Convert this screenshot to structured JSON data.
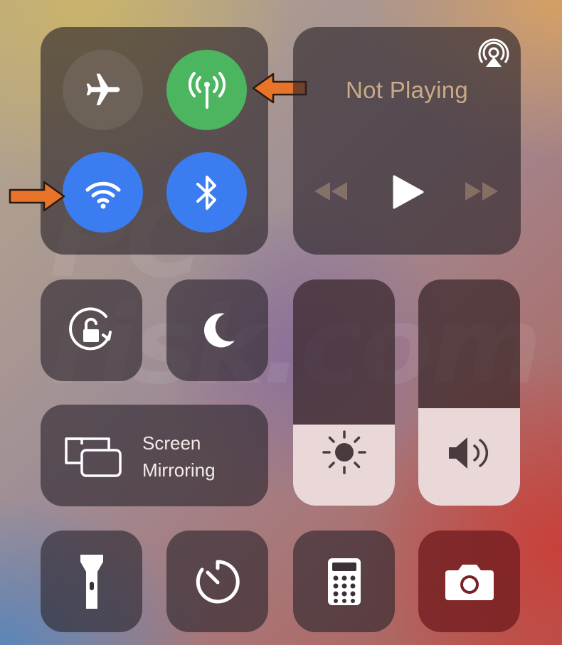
{
  "connectivity": {
    "airplane_mode": {
      "icon": "airplane-icon",
      "state": "off"
    },
    "cellular_data": {
      "icon": "antenna-icon",
      "state": "on",
      "color": "#4cb560"
    },
    "wifi": {
      "icon": "wifi-icon",
      "state": "on",
      "color": "#3b7cf0"
    },
    "bluetooth": {
      "icon": "bluetooth-icon",
      "state": "on",
      "color": "#3b7cf0"
    }
  },
  "now_playing": {
    "status": "Not Playing",
    "airplay_icon": "airplay-icon",
    "controls": [
      "rewind-icon",
      "play-icon",
      "fast-forward-icon"
    ]
  },
  "toggles": {
    "orientation_lock": {
      "icon": "rotation-lock-icon"
    },
    "do_not_disturb": {
      "icon": "moon-icon"
    }
  },
  "screen_mirroring": {
    "line1": "Screen",
    "line2": "Mirroring",
    "icon": "screen-mirroring-icon"
  },
  "sliders": {
    "brightness": {
      "icon": "sun-icon",
      "level": 0.36
    },
    "volume": {
      "icon": "speaker-icon",
      "level": 0.43
    }
  },
  "shortcuts": [
    {
      "name": "flashlight",
      "icon": "flashlight-icon"
    },
    {
      "name": "timer",
      "icon": "timer-icon"
    },
    {
      "name": "calculator",
      "icon": "calculator-icon"
    },
    {
      "name": "camera",
      "icon": "camera-icon"
    }
  ],
  "annotations": {
    "arrow_color": "#e8742a"
  },
  "watermark": "PC risk.com"
}
